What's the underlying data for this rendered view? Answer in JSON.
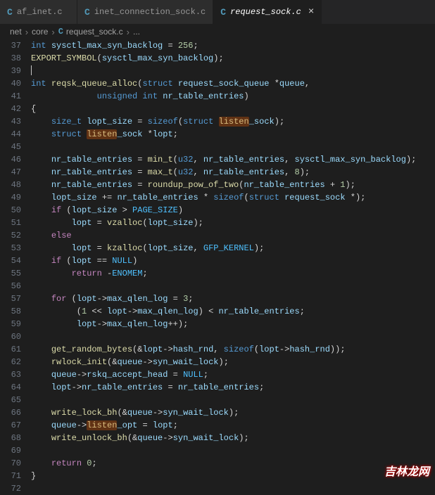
{
  "tabs": [
    {
      "icon": "C",
      "label": "af_inet.c",
      "active": false
    },
    {
      "icon": "C",
      "label": "inet_connection_sock.c",
      "active": false
    },
    {
      "icon": "C",
      "label": "request_sock.c",
      "active": true
    }
  ],
  "breadcrumbs": {
    "seg0": "net",
    "seg1": "core",
    "seg2_icon": "C",
    "seg2": "request_sock.c",
    "seg3": "..."
  },
  "highlight": "listen",
  "lines": [
    {
      "n": 37,
      "tokens": [
        [
          "int ",
          "t-type"
        ],
        [
          "sysctl_max_syn_backlog",
          "t-var"
        ],
        [
          " = ",
          "t-op"
        ],
        [
          "256",
          "t-num"
        ],
        [
          ";",
          ""
        ]
      ]
    },
    {
      "n": 38,
      "tokens": [
        [
          "EXPORT_SYMBOL",
          "t-func"
        ],
        [
          "(",
          ""
        ],
        [
          "sysctl_max_syn_backlog",
          "t-var"
        ],
        [
          ")",
          ""
        ],
        [
          ";",
          ""
        ]
      ]
    },
    {
      "n": 39,
      "tokens": [
        [
          "",
          ""
        ]
      ]
    },
    {
      "n": 40,
      "tokens": [
        [
          "int ",
          "t-type"
        ],
        [
          "reqsk_queue_alloc",
          "t-func"
        ],
        [
          "(",
          ""
        ],
        [
          "struct ",
          "t-key"
        ],
        [
          "request_sock_queue ",
          "t-var"
        ],
        [
          "*",
          ""
        ],
        [
          "queue",
          "t-var"
        ],
        [
          ",",
          ""
        ]
      ]
    },
    {
      "n": 41,
      "tokens": [
        [
          "             ",
          ""
        ],
        [
          "unsigned int ",
          "t-type"
        ],
        [
          "nr_table_entries",
          "t-var"
        ],
        [
          ")",
          ""
        ]
      ]
    },
    {
      "n": 42,
      "tokens": [
        [
          "{",
          ""
        ]
      ]
    },
    {
      "n": 43,
      "tokens": [
        [
          "    ",
          ""
        ],
        [
          "size_t ",
          "t-type"
        ],
        [
          "lopt_size",
          "t-var"
        ],
        [
          " = ",
          "t-op"
        ],
        [
          "sizeof",
          "t-key"
        ],
        [
          "(",
          ""
        ],
        [
          "struct ",
          "t-key"
        ],
        [
          "listen",
          "hl"
        ],
        [
          "_sock",
          "t-var"
        ],
        [
          ")",
          ""
        ],
        [
          ";",
          ""
        ]
      ]
    },
    {
      "n": 44,
      "tokens": [
        [
          "    ",
          ""
        ],
        [
          "struct ",
          "t-key"
        ],
        [
          "listen",
          "hl"
        ],
        [
          "_sock ",
          "t-var"
        ],
        [
          "*",
          ""
        ],
        [
          "lopt",
          "t-var"
        ],
        [
          ";",
          ""
        ]
      ]
    },
    {
      "n": 45,
      "tokens": [
        [
          "",
          ""
        ]
      ]
    },
    {
      "n": 46,
      "tokens": [
        [
          "    ",
          ""
        ],
        [
          "nr_table_entries",
          "t-var"
        ],
        [
          " = ",
          "t-op"
        ],
        [
          "min_t",
          "t-func"
        ],
        [
          "(",
          ""
        ],
        [
          "u32",
          "t-type"
        ],
        [
          ", ",
          ""
        ],
        [
          "nr_table_entries",
          "t-var"
        ],
        [
          ", ",
          ""
        ],
        [
          "sysctl_max_syn_backlog",
          "t-var"
        ],
        [
          ")",
          ""
        ],
        [
          ";",
          ""
        ]
      ]
    },
    {
      "n": 47,
      "tokens": [
        [
          "    ",
          ""
        ],
        [
          "nr_table_entries",
          "t-var"
        ],
        [
          " = ",
          "t-op"
        ],
        [
          "max_t",
          "t-func"
        ],
        [
          "(",
          ""
        ],
        [
          "u32",
          "t-type"
        ],
        [
          ", ",
          ""
        ],
        [
          "nr_table_entries",
          "t-var"
        ],
        [
          ", ",
          ""
        ],
        [
          "8",
          "t-num"
        ],
        [
          ")",
          ""
        ],
        [
          ";",
          ""
        ]
      ]
    },
    {
      "n": 48,
      "tokens": [
        [
          "    ",
          ""
        ],
        [
          "nr_table_entries",
          "t-var"
        ],
        [
          " = ",
          "t-op"
        ],
        [
          "roundup_pow_of_two",
          "t-func"
        ],
        [
          "(",
          ""
        ],
        [
          "nr_table_entries",
          "t-var"
        ],
        [
          " + ",
          "t-op"
        ],
        [
          "1",
          "t-num"
        ],
        [
          ")",
          ""
        ],
        [
          ";",
          ""
        ]
      ]
    },
    {
      "n": 49,
      "tokens": [
        [
          "    ",
          ""
        ],
        [
          "lopt_size",
          "t-var"
        ],
        [
          " += ",
          "t-op"
        ],
        [
          "nr_table_entries",
          "t-var"
        ],
        [
          " * ",
          "t-op"
        ],
        [
          "sizeof",
          "t-key"
        ],
        [
          "(",
          ""
        ],
        [
          "struct ",
          "t-key"
        ],
        [
          "request_sock ",
          "t-var"
        ],
        [
          "*",
          ""
        ],
        [
          ")",
          ""
        ],
        [
          ";",
          ""
        ]
      ]
    },
    {
      "n": 50,
      "tokens": [
        [
          "    ",
          ""
        ],
        [
          "if ",
          "t-ctl"
        ],
        [
          "(",
          ""
        ],
        [
          "lopt_size",
          "t-var"
        ],
        [
          " > ",
          "t-op"
        ],
        [
          "PAGE_SIZE",
          "t-macro"
        ],
        [
          ")",
          ""
        ]
      ]
    },
    {
      "n": 51,
      "tokens": [
        [
          "        ",
          ""
        ],
        [
          "lopt",
          "t-var"
        ],
        [
          " = ",
          "t-op"
        ],
        [
          "vzalloc",
          "t-func"
        ],
        [
          "(",
          ""
        ],
        [
          "lopt_size",
          "t-var"
        ],
        [
          ")",
          ""
        ],
        [
          ";",
          ""
        ]
      ]
    },
    {
      "n": 52,
      "tokens": [
        [
          "    ",
          ""
        ],
        [
          "else",
          "t-ctl"
        ]
      ]
    },
    {
      "n": 53,
      "tokens": [
        [
          "        ",
          ""
        ],
        [
          "lopt",
          "t-var"
        ],
        [
          " = ",
          "t-op"
        ],
        [
          "kzalloc",
          "t-func"
        ],
        [
          "(",
          ""
        ],
        [
          "lopt_size",
          "t-var"
        ],
        [
          ", ",
          ""
        ],
        [
          "GFP_KERNEL",
          "t-macro"
        ],
        [
          ")",
          ""
        ],
        [
          ";",
          ""
        ]
      ]
    },
    {
      "n": 54,
      "tokens": [
        [
          "    ",
          ""
        ],
        [
          "if ",
          "t-ctl"
        ],
        [
          "(",
          ""
        ],
        [
          "lopt",
          "t-var"
        ],
        [
          " == ",
          "t-op"
        ],
        [
          "NULL",
          "t-macro"
        ],
        [
          ")",
          ""
        ]
      ]
    },
    {
      "n": 55,
      "tokens": [
        [
          "        ",
          ""
        ],
        [
          "return ",
          "t-ctl"
        ],
        [
          "-",
          ""
        ],
        [
          "ENOMEM",
          "t-macro"
        ],
        [
          ";",
          ""
        ]
      ]
    },
    {
      "n": 56,
      "tokens": [
        [
          "",
          ""
        ]
      ]
    },
    {
      "n": 57,
      "tokens": [
        [
          "    ",
          ""
        ],
        [
          "for ",
          "t-ctl"
        ],
        [
          "(",
          ""
        ],
        [
          "lopt",
          "t-var"
        ],
        [
          "->",
          ""
        ],
        [
          "max_qlen_log",
          "t-var"
        ],
        [
          " = ",
          "t-op"
        ],
        [
          "3",
          "t-num"
        ],
        [
          ";",
          ""
        ]
      ]
    },
    {
      "n": 58,
      "tokens": [
        [
          "         (",
          ""
        ],
        [
          "1",
          "t-num"
        ],
        [
          " << ",
          "t-op"
        ],
        [
          "lopt",
          "t-var"
        ],
        [
          "->",
          ""
        ],
        [
          "max_qlen_log",
          "t-var"
        ],
        [
          ")",
          ""
        ],
        [
          " < ",
          "t-op"
        ],
        [
          "nr_table_entries",
          "t-var"
        ],
        [
          ";",
          ""
        ]
      ]
    },
    {
      "n": 59,
      "tokens": [
        [
          "         ",
          ""
        ],
        [
          "lopt",
          "t-var"
        ],
        [
          "->",
          ""
        ],
        [
          "max_qlen_log",
          "t-var"
        ],
        [
          "++",
          ""
        ],
        [
          ")",
          ""
        ],
        [
          ";",
          ""
        ]
      ]
    },
    {
      "n": 60,
      "tokens": [
        [
          "",
          ""
        ]
      ]
    },
    {
      "n": 61,
      "tokens": [
        [
          "    ",
          ""
        ],
        [
          "get_random_bytes",
          "t-func"
        ],
        [
          "(",
          ""
        ],
        [
          "&",
          ""
        ],
        [
          "lopt",
          "t-var"
        ],
        [
          "->",
          ""
        ],
        [
          "hash_rnd",
          "t-var"
        ],
        [
          ", ",
          ""
        ],
        [
          "sizeof",
          "t-key"
        ],
        [
          "(",
          ""
        ],
        [
          "lopt",
          "t-var"
        ],
        [
          "->",
          ""
        ],
        [
          "hash_rnd",
          "t-var"
        ],
        [
          "))",
          ""
        ],
        [
          ";",
          ""
        ]
      ]
    },
    {
      "n": 62,
      "tokens": [
        [
          "    ",
          ""
        ],
        [
          "rwlock_init",
          "t-func"
        ],
        [
          "(",
          ""
        ],
        [
          "&",
          ""
        ],
        [
          "queue",
          "t-var"
        ],
        [
          "->",
          ""
        ],
        [
          "syn_wait_lock",
          "t-var"
        ],
        [
          ")",
          ""
        ],
        [
          ";",
          ""
        ]
      ]
    },
    {
      "n": 63,
      "tokens": [
        [
          "    ",
          ""
        ],
        [
          "queue",
          "t-var"
        ],
        [
          "->",
          ""
        ],
        [
          "rskq_accept_head",
          "t-var"
        ],
        [
          " = ",
          "t-op"
        ],
        [
          "NULL",
          "t-macro"
        ],
        [
          ";",
          ""
        ]
      ]
    },
    {
      "n": 64,
      "tokens": [
        [
          "    ",
          ""
        ],
        [
          "lopt",
          "t-var"
        ],
        [
          "->",
          ""
        ],
        [
          "nr_table_entries",
          "t-var"
        ],
        [
          " = ",
          "t-op"
        ],
        [
          "nr_table_entries",
          "t-var"
        ],
        [
          ";",
          ""
        ]
      ]
    },
    {
      "n": 65,
      "tokens": [
        [
          "",
          ""
        ]
      ]
    },
    {
      "n": 66,
      "tokens": [
        [
          "    ",
          ""
        ],
        [
          "write_lock_bh",
          "t-func"
        ],
        [
          "(",
          ""
        ],
        [
          "&",
          ""
        ],
        [
          "queue",
          "t-var"
        ],
        [
          "->",
          ""
        ],
        [
          "syn_wait_lock",
          "t-var"
        ],
        [
          ")",
          ""
        ],
        [
          ";",
          ""
        ]
      ]
    },
    {
      "n": 67,
      "tokens": [
        [
          "    ",
          ""
        ],
        [
          "queue",
          "t-var"
        ],
        [
          "->",
          ""
        ],
        [
          "listen",
          "hl"
        ],
        [
          "_opt",
          "t-var"
        ],
        [
          " = ",
          "t-op"
        ],
        [
          "lopt",
          "t-var"
        ],
        [
          ";",
          ""
        ]
      ]
    },
    {
      "n": 68,
      "tokens": [
        [
          "    ",
          ""
        ],
        [
          "write_unlock_bh",
          "t-func"
        ],
        [
          "(",
          ""
        ],
        [
          "&",
          ""
        ],
        [
          "queue",
          "t-var"
        ],
        [
          "->",
          ""
        ],
        [
          "syn_wait_lock",
          "t-var"
        ],
        [
          ")",
          ""
        ],
        [
          ";",
          ""
        ]
      ]
    },
    {
      "n": 69,
      "tokens": [
        [
          "",
          ""
        ]
      ]
    },
    {
      "n": 70,
      "tokens": [
        [
          "    ",
          ""
        ],
        [
          "return ",
          "t-ctl"
        ],
        [
          "0",
          "t-num"
        ],
        [
          ";",
          ""
        ]
      ]
    },
    {
      "n": 71,
      "tokens": [
        [
          "}",
          ""
        ]
      ]
    },
    {
      "n": 72,
      "tokens": [
        [
          "",
          ""
        ]
      ]
    }
  ],
  "watermark": "吉林龙网"
}
